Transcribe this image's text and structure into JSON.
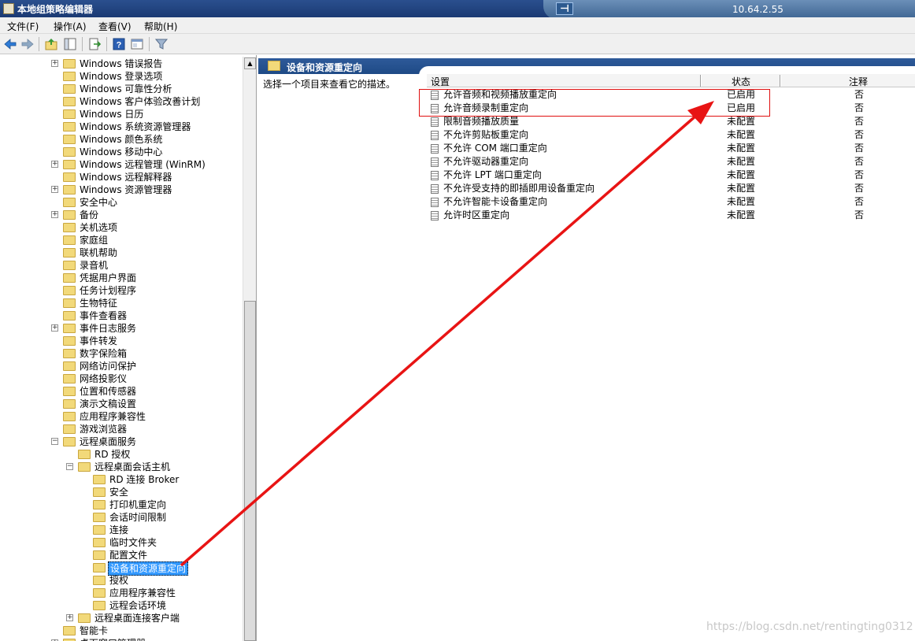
{
  "window": {
    "title": "本地组策略编辑器",
    "remote_host": "10.64.2.55",
    "remote_pin": "⊣"
  },
  "menu": [
    {
      "label": "文件(F)"
    },
    {
      "label": "操作(A)"
    },
    {
      "label": "查看(V)"
    },
    {
      "label": "帮助(H)"
    }
  ],
  "toolbar": {
    "back": "back-arrow-icon",
    "forward": "forward-arrow-icon",
    "up": "up-folder-icon",
    "show_hide": "show-hide-tree-icon",
    "export": "export-list-icon",
    "help": "help-icon",
    "properties": "properties-icon",
    "filter": "filter-icon"
  },
  "tree": [
    {
      "label": "Windows 错误报告",
      "expander": "+",
      "level": 0
    },
    {
      "label": "Windows 登录选项",
      "expander": "",
      "level": 0
    },
    {
      "label": "Windows 可靠性分析",
      "expander": "",
      "level": 0
    },
    {
      "label": "Windows 客户体验改善计划",
      "expander": "",
      "level": 0
    },
    {
      "label": "Windows 日历",
      "expander": "",
      "level": 0
    },
    {
      "label": "Windows 系统资源管理器",
      "expander": "",
      "level": 0
    },
    {
      "label": "Windows 颜色系统",
      "expander": "",
      "level": 0
    },
    {
      "label": "Windows 移动中心",
      "expander": "",
      "level": 0
    },
    {
      "label": "Windows 远程管理 (WinRM)",
      "expander": "+",
      "level": 0
    },
    {
      "label": "Windows 远程解释器",
      "expander": "",
      "level": 0
    },
    {
      "label": "Windows 资源管理器",
      "expander": "+",
      "level": 0
    },
    {
      "label": "安全中心",
      "expander": "",
      "level": 0
    },
    {
      "label": "备份",
      "expander": "+",
      "level": 0
    },
    {
      "label": "关机选项",
      "expander": "",
      "level": 0
    },
    {
      "label": "家庭组",
      "expander": "",
      "level": 0
    },
    {
      "label": "联机帮助",
      "expander": "",
      "level": 0
    },
    {
      "label": "录音机",
      "expander": "",
      "level": 0
    },
    {
      "label": "凭据用户界面",
      "expander": "",
      "level": 0
    },
    {
      "label": "任务计划程序",
      "expander": "",
      "level": 0
    },
    {
      "label": "生物特征",
      "expander": "",
      "level": 0
    },
    {
      "label": "事件查看器",
      "expander": "",
      "level": 0
    },
    {
      "label": "事件日志服务",
      "expander": "+",
      "level": 0
    },
    {
      "label": "事件转发",
      "expander": "",
      "level": 0
    },
    {
      "label": "数字保险箱",
      "expander": "",
      "level": 0
    },
    {
      "label": "网络访问保护",
      "expander": "",
      "level": 0
    },
    {
      "label": "网络投影仪",
      "expander": "",
      "level": 0
    },
    {
      "label": "位置和传感器",
      "expander": "",
      "level": 0
    },
    {
      "label": "演示文稿设置",
      "expander": "",
      "level": 0
    },
    {
      "label": "应用程序兼容性",
      "expander": "",
      "level": 0
    },
    {
      "label": "游戏浏览器",
      "expander": "",
      "level": 0
    },
    {
      "label": "远程桌面服务",
      "expander": "−",
      "level": 0
    },
    {
      "label": "RD 授权",
      "expander": "",
      "level": 1
    },
    {
      "label": "远程桌面会话主机",
      "expander": "−",
      "level": 1
    },
    {
      "label": "RD 连接 Broker",
      "expander": "",
      "level": 2
    },
    {
      "label": "安全",
      "expander": "",
      "level": 2
    },
    {
      "label": "打印机重定向",
      "expander": "",
      "level": 2
    },
    {
      "label": "会话时间限制",
      "expander": "",
      "level": 2
    },
    {
      "label": "连接",
      "expander": "",
      "level": 2
    },
    {
      "label": "临时文件夹",
      "expander": "",
      "level": 2
    },
    {
      "label": "配置文件",
      "expander": "",
      "level": 2
    },
    {
      "label": "设备和资源重定向",
      "expander": "",
      "level": 2,
      "selected": true
    },
    {
      "label": "授权",
      "expander": "",
      "level": 2
    },
    {
      "label": "应用程序兼容性",
      "expander": "",
      "level": 2
    },
    {
      "label": "远程会话环境",
      "expander": "",
      "level": 2
    },
    {
      "label": "远程桌面连接客户端",
      "expander": "+",
      "level": 1
    },
    {
      "label": "智能卡",
      "expander": "",
      "level": 0
    },
    {
      "label": "桌面窗口管理器",
      "expander": "+",
      "level": 0
    }
  ],
  "right": {
    "header_title": "设备和资源重定向",
    "description": "选择一个项目来查看它的描述。",
    "columns": {
      "name": "设置",
      "state": "状态",
      "note": "注释"
    },
    "rows": [
      {
        "name": "允许音频和视频播放重定向",
        "state": "已启用",
        "note": "否"
      },
      {
        "name": "允许音频录制重定向",
        "state": "已启用",
        "note": "否"
      },
      {
        "name": "限制音频播放质量",
        "state": "未配置",
        "note": "否"
      },
      {
        "name": "不允许剪贴板重定向",
        "state": "未配置",
        "note": "否"
      },
      {
        "name": "不允许 COM 端口重定向",
        "state": "未配置",
        "note": "否"
      },
      {
        "name": "不允许驱动器重定向",
        "state": "未配置",
        "note": "否"
      },
      {
        "name": "不允许 LPT 端口重定向",
        "state": "未配置",
        "note": "否"
      },
      {
        "name": "不允许受支持的即插即用设备重定向",
        "state": "未配置",
        "note": "否"
      },
      {
        "name": "不允许智能卡设备重定向",
        "state": "未配置",
        "note": "否"
      },
      {
        "name": "允许时区重定向",
        "state": "未配置",
        "note": "否"
      }
    ]
  },
  "annotation": {
    "color": "#e81414"
  },
  "watermark": "https://blog.csdn.net/rentingting0312"
}
